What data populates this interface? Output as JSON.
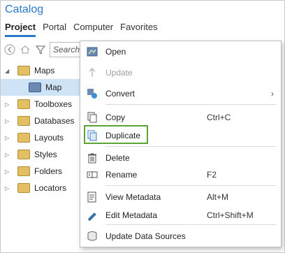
{
  "pane": {
    "title": "Catalog",
    "tabs": [
      "Project",
      "Portal",
      "Computer",
      "Favorites"
    ],
    "search_placeholder": "Search"
  },
  "tree": {
    "items": [
      {
        "label": "Maps",
        "icon": "folder-icon",
        "expanded": true
      },
      {
        "label": "Map",
        "icon": "map-icon",
        "selected": true
      },
      {
        "label": "Toolboxes",
        "icon": "folder-icon"
      },
      {
        "label": "Databases",
        "icon": "folder-icon"
      },
      {
        "label": "Layouts",
        "icon": "folder-icon"
      },
      {
        "label": "Styles",
        "icon": "folder-icon"
      },
      {
        "label": "Folders",
        "icon": "folder-icon"
      },
      {
        "label": "Locators",
        "icon": "folder-icon"
      }
    ]
  },
  "menu": {
    "items": [
      {
        "label": "Open",
        "icon": "map-icon"
      },
      {
        "label": "Update",
        "icon": "update-icon",
        "disabled": true
      },
      {
        "label": "Convert",
        "icon": "convert-icon",
        "submenu": true
      },
      {
        "label": "Copy",
        "icon": "copy-icon",
        "shortcut": "Ctrl+C"
      },
      {
        "label": "Duplicate",
        "icon": "duplicate-icon",
        "highlighted": true
      },
      {
        "label": "Delete",
        "icon": "trash-icon"
      },
      {
        "label": "Rename",
        "icon": "rename-icon",
        "shortcut": "F2"
      },
      {
        "label": "View Metadata",
        "icon": "view-metadata-icon",
        "shortcut": "Alt+M"
      },
      {
        "label": "Edit Metadata",
        "icon": "edit-metadata-icon",
        "shortcut": "Ctrl+Shift+M"
      },
      {
        "label": "Update Data Sources",
        "icon": "update-data-sources-icon"
      }
    ]
  },
  "colors": {
    "accent": "#2a78c8",
    "highlight_border": "#5aa533",
    "selected_row": "#cfe3f7"
  }
}
